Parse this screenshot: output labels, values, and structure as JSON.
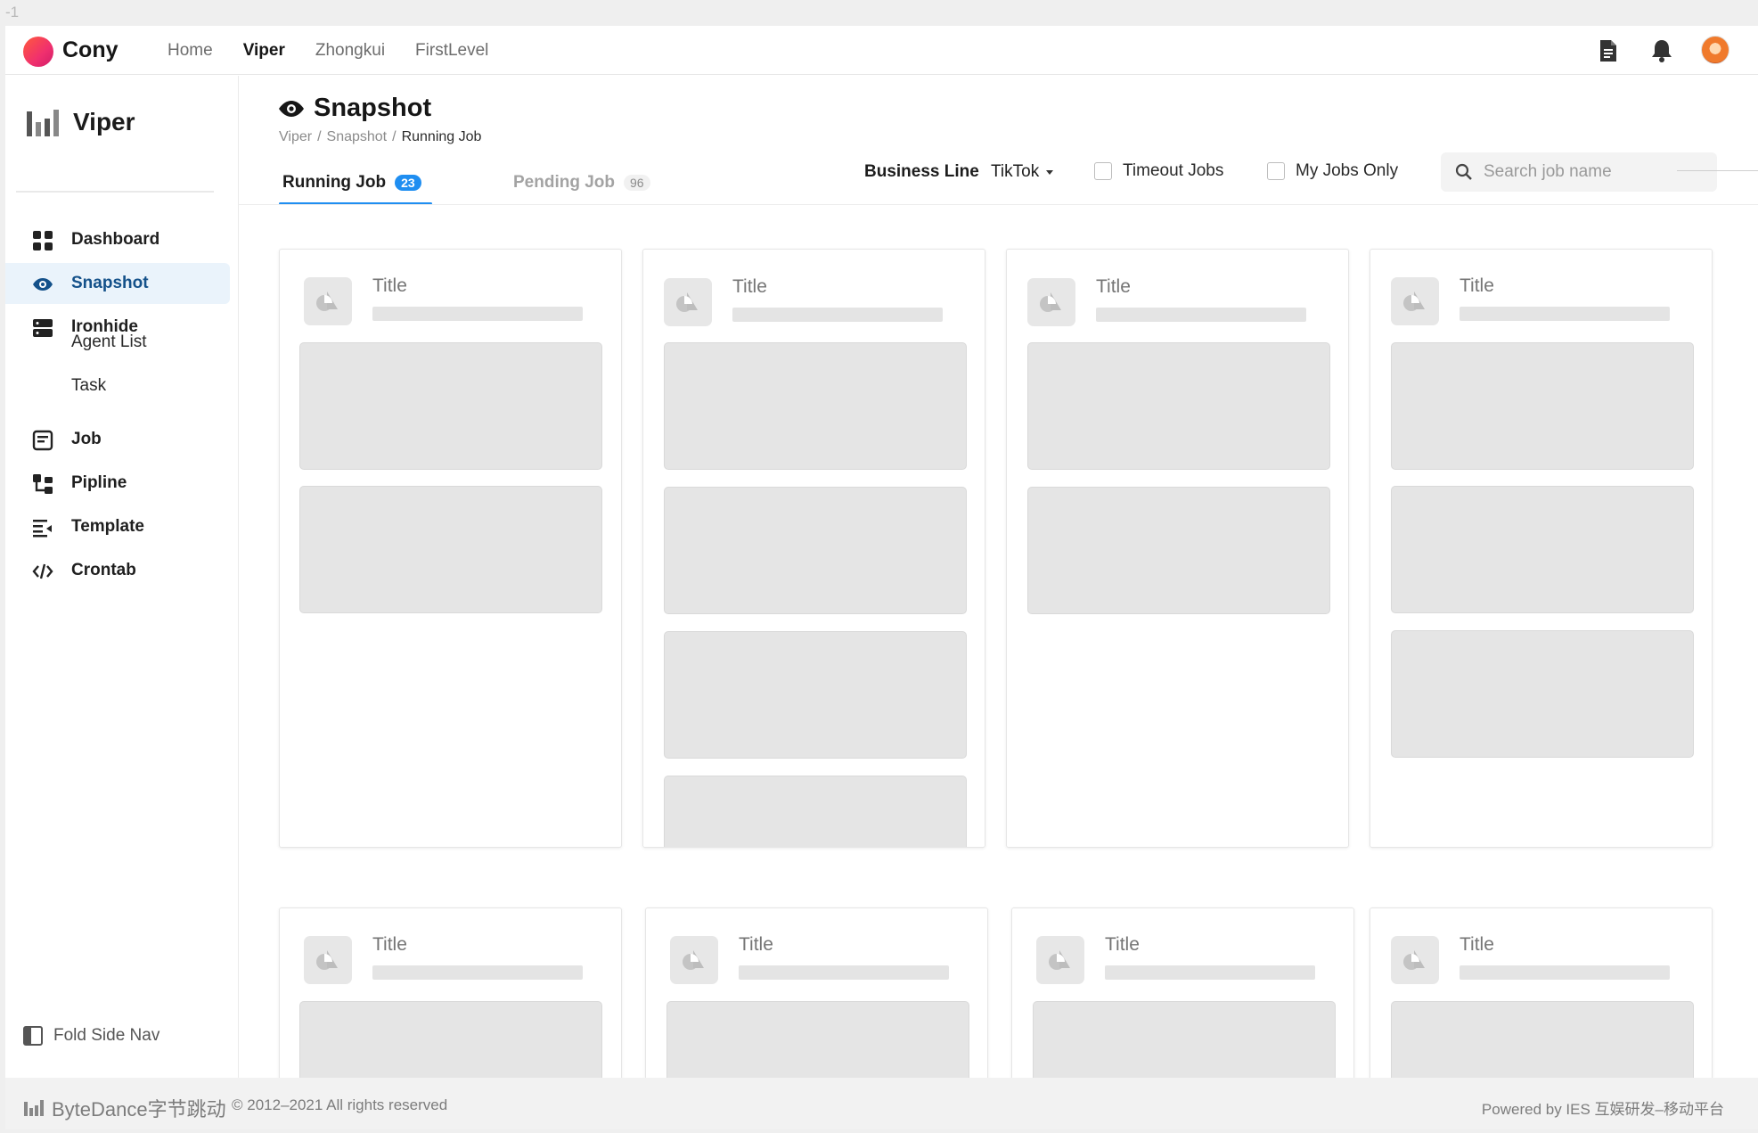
{
  "frame_label": "-1",
  "topbar": {
    "brand": "Cony",
    "nav": [
      {
        "label": "Home",
        "active": false
      },
      {
        "label": "Viper",
        "active": true
      },
      {
        "label": "Zhongkui",
        "active": false
      },
      {
        "label": "FirstLevel",
        "active": false
      }
    ],
    "icons": [
      "document-icon",
      "bell-icon",
      "avatar"
    ]
  },
  "sidebar": {
    "brand": "Viper",
    "items": [
      {
        "label": "Dashboard",
        "icon": "dashboard-icon"
      },
      {
        "label": "Snapshot",
        "icon": "eye-icon",
        "active": true
      },
      {
        "label": "Ironhide",
        "icon": "server-icon"
      },
      {
        "label": "Agent List",
        "sub": true
      },
      {
        "label": "Task",
        "sub": true
      },
      {
        "label": "Job",
        "icon": "job-icon"
      },
      {
        "label": "Pipline",
        "icon": "pipeline-icon"
      },
      {
        "label": "Template",
        "icon": "template-icon"
      },
      {
        "label": "Crontab",
        "icon": "code-icon"
      }
    ],
    "fold_label": "Fold Side Nav"
  },
  "page": {
    "title": "Snapshot",
    "breadcrumb": [
      "Viper",
      "Snapshot",
      "Running Job"
    ],
    "tabs": [
      {
        "label": "Running Job",
        "count": "23",
        "active": true
      },
      {
        "label": "Pending Job",
        "count": "96",
        "active": false
      }
    ],
    "filters": {
      "business_line_label": "Business Line",
      "business_line_value": "TikTok",
      "timeout_jobs_label": "Timeout Jobs",
      "my_jobs_only_label": "My Jobs Only",
      "search_placeholder": "Search job name"
    }
  },
  "cards": [
    {
      "title": "Title",
      "blocks": 2
    },
    {
      "title": "Title",
      "blocks": 4
    },
    {
      "title": "Title",
      "blocks": 2
    },
    {
      "title": "Title",
      "blocks": 3
    },
    {
      "title": "Title",
      "blocks": 1
    },
    {
      "title": "Title",
      "blocks": 1
    },
    {
      "title": "Title",
      "blocks": 1
    },
    {
      "title": "Title",
      "blocks": 1
    }
  ],
  "footer": {
    "logo_text": "ByteDance字节跳动",
    "copyright": "© 2012–2021 All rights reserved",
    "powered": "Powered by IES 互娱研发–移动平台"
  },
  "colors": {
    "accent": "#1f8ef1",
    "active_nav_bg": "#eaf3fb",
    "active_nav_text": "#14518a",
    "placeholder_block": "#e5e5e5"
  }
}
